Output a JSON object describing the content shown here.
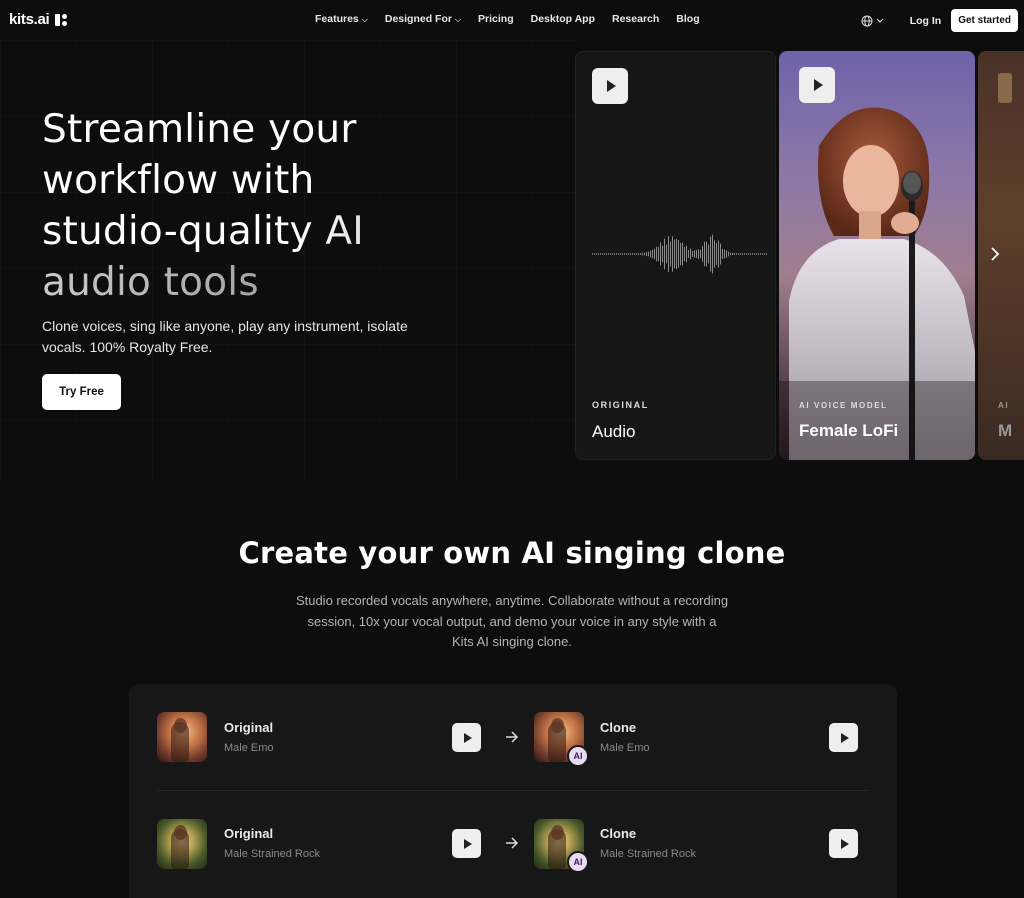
{
  "nav": {
    "logo": "kits.ai",
    "links": [
      {
        "label": "Features",
        "has_dropdown": true
      },
      {
        "label": "Designed For",
        "has_dropdown": true
      },
      {
        "label": "Pricing",
        "has_dropdown": false
      },
      {
        "label": "Desktop App",
        "has_dropdown": false
      },
      {
        "label": "Research",
        "has_dropdown": false
      },
      {
        "label": "Blog",
        "has_dropdown": false
      }
    ],
    "chevron": "⌵",
    "login_label": "Log In",
    "get_started_label": "Get started"
  },
  "hero": {
    "title_lines": [
      "Streamline your",
      "workflow with",
      "studio-quality AI",
      "audio tools"
    ],
    "subtitle": "Clone voices, sing like anyone, play any instrument, isolate vocals. 100% Royalty Free.",
    "cta_label": "Try Free"
  },
  "cards": [
    {
      "kicker": "ORIGINAL",
      "title": "Audio"
    },
    {
      "kicker": "AI VOICE MODEL",
      "title": "Female LoFi"
    },
    {
      "kicker": "AI",
      "title": "M"
    }
  ],
  "section2": {
    "title": "Create your own AI singing clone",
    "subtitle": "Studio recorded vocals anywhere, anytime. Collaborate without a recording session, 10x your vocal output, and demo your voice in any style with a Kits AI singing clone."
  },
  "comparisons": [
    {
      "original_title": "Original",
      "original_sub": "Male Emo",
      "clone_title": "Clone",
      "clone_sub": "Male Emo",
      "badge": "AI"
    },
    {
      "original_title": "Original",
      "original_sub": "Male Strained Rock",
      "clone_title": "Clone",
      "clone_sub": "Male Strained Rock",
      "badge": "AI"
    }
  ],
  "icons": {
    "globe": "globe-icon",
    "play": "play-icon",
    "arrow": "arrow-right-icon",
    "next": "chevron-right-icon"
  }
}
